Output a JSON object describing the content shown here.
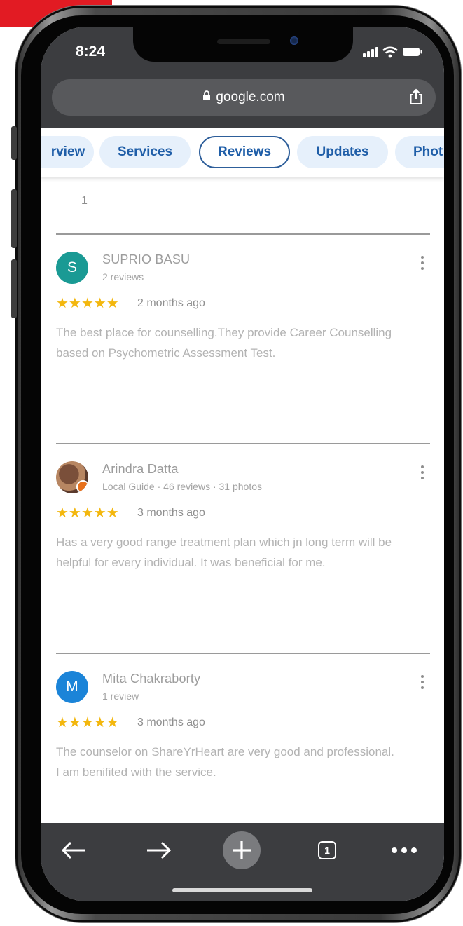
{
  "status_bar": {
    "time": "8:24"
  },
  "browser": {
    "url": "google.com",
    "tab_count": "1"
  },
  "tabs": [
    {
      "label": "Overview",
      "visible_label": "rview"
    },
    {
      "label": "Services"
    },
    {
      "label": "Reviews",
      "active": true
    },
    {
      "label": "Updates"
    },
    {
      "label": "Photos",
      "visible_label": "Phot"
    }
  ],
  "page_number": "1",
  "reviews": [
    {
      "avatar_letter": "S",
      "avatar_color": "#1a9a94",
      "name": "SUPRIO BASU",
      "meta": "2 reviews",
      "rating": 5,
      "stars": "★★★★★",
      "time": "2 months ago",
      "text": "The best place for counselling.They provide Career Counselling based on Psychometric Assessment Test."
    },
    {
      "avatar_letter": "",
      "avatar_color": "#7a4f3a",
      "name": "Arindra Datta",
      "meta": "Local Guide · 46 reviews · 31 photos",
      "rating": 5,
      "stars": "★★★★★",
      "time": "3 months ago",
      "text": "Has a very good range treatment plan which jn long term will be helpful for every individual. It was beneficial for me."
    },
    {
      "avatar_letter": "M",
      "avatar_color": "#1b84d8",
      "name": "Mita Chakraborty",
      "meta": "1 review",
      "rating": 5,
      "stars": "★★★★★",
      "time": "3 months ago",
      "text": "The counselor on ShareYrHeart are very good and professional. I am benifited with the service."
    }
  ],
  "colors": {
    "accent_tab_text": "#1f5ea8",
    "tab_background": "#e6f0fb",
    "star": "#f3b70e",
    "browser_chrome": "#3c3d40",
    "url_field": "#58595c",
    "brand_red": "#e21b23"
  },
  "icons": {
    "lock": "lock-icon",
    "share": "share-icon",
    "back": "arrow-left-icon",
    "forward": "arrow-right-icon",
    "new_tab": "plus-icon",
    "tab_switcher": "tab-switcher-icon",
    "menu": "more-horizontal-icon",
    "review_more": "more-vertical-icon"
  }
}
